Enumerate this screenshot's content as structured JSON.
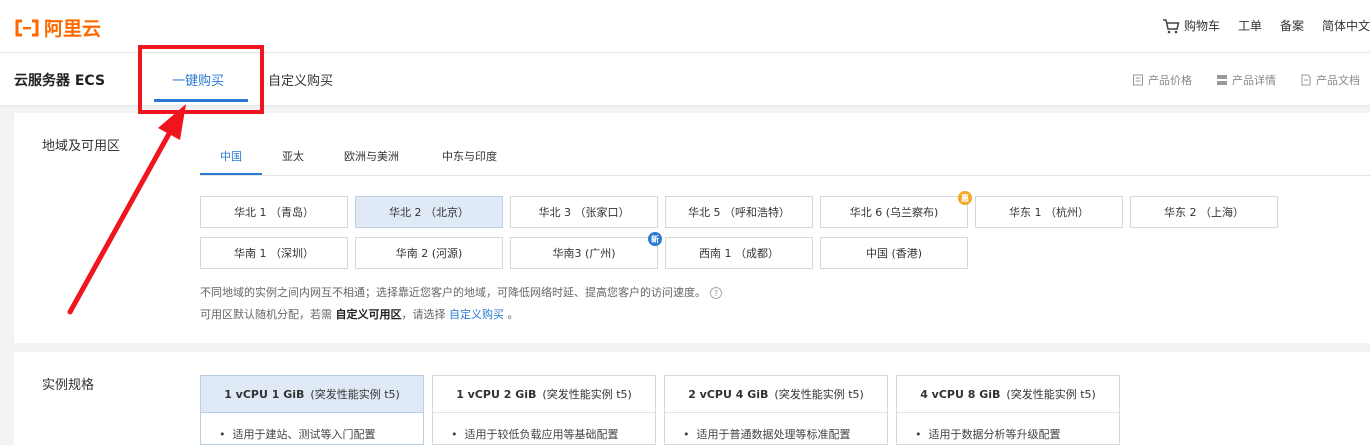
{
  "header": {
    "logo_text": "阿里云",
    "cart_label": "购物车",
    "links": [
      "工单",
      "备案",
      "简体中文"
    ]
  },
  "product": {
    "title": "云服务器 ECS",
    "tabs": [
      {
        "label": "一键购买",
        "active": true
      },
      {
        "label": "自定义购买",
        "active": false
      }
    ],
    "links": [
      "产品价格",
      "产品详情",
      "产品文档"
    ]
  },
  "region": {
    "label": "地域及可用区",
    "tabs": [
      "中国",
      "亚太",
      "欧洲与美洲",
      "中东与印度"
    ],
    "zones_row1": [
      "华北 1 （青岛）",
      "华北 2 （北京）",
      "华北 3 （张家口）",
      "华北 5 （呼和浩特）",
      "华北 6 (乌兰察布)",
      "华东 1 （杭州）",
      "华东 2 （上海）"
    ],
    "zones_row2": [
      "华南 1 （深圳）",
      "华南 2 (河源)",
      "华南3 (广州)",
      "西南 1 （成都）",
      "中国 (香港)"
    ],
    "selected_zone": "华北 2 （北京）",
    "badge_discount": "惠",
    "badge_new": "新",
    "note1": "不同地域的实例之间内网互不相通；选择靠近您客户的地域，可降低网络时延、提高您客户的访问速度。",
    "help_glyph": "?",
    "note2_pre": "可用区默认随机分配，若需",
    "note2_bold": "自定义可用区",
    "note2_mid": "，请选择",
    "note2_link": "自定义购买",
    "note2_end": "。"
  },
  "specs": {
    "label": "实例规格",
    "items": [
      {
        "name": "1 vCPU 1 GiB",
        "type": "(突发性能实例 t5)",
        "desc": "适用于建站、测试等入门配置"
      },
      {
        "name": "1 vCPU 2 GiB",
        "type": "(突发性能实例 t5)",
        "desc": "适用于较低负载应用等基础配置"
      },
      {
        "name": "2 vCPU 4 GiB",
        "type": "(突发性能实例 t5)",
        "desc": "适用于普通数据处理等标准配置"
      },
      {
        "name": "4 vCPU 8 GiB",
        "type": "(突发性能实例 t5)",
        "desc": "适用于数据分析等升级配置"
      }
    ]
  },
  "colors": {
    "brand": "#ff6a00",
    "accent": "#2a7ad2",
    "annotation": "#f0141e"
  }
}
